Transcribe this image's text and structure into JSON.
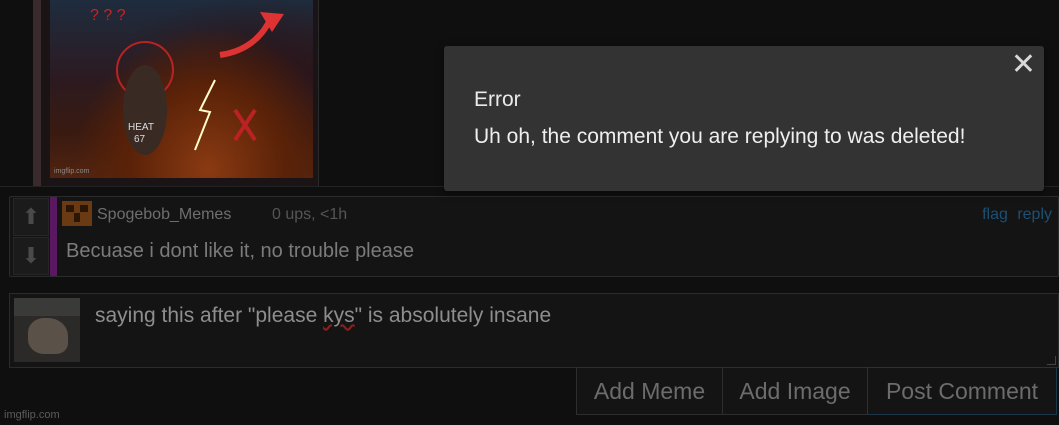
{
  "meme": {
    "watermark": "imgflip.com",
    "icon": "meme-image"
  },
  "comment": {
    "username": "Spogebob_Memes",
    "meta": "0 ups, <1h",
    "actions": {
      "flag": "flag",
      "reply": "reply"
    },
    "text": "Becuase i dont like it, no trouble please",
    "accent_color": "#5a1862"
  },
  "reply_box": {
    "value_before": "saying this after \"please ",
    "value_misspelled": "kys",
    "value_after": "\" is absolutely insane"
  },
  "buttons": {
    "add_meme": "Add Meme",
    "add_image": "Add Image",
    "post_comment": "Post Comment"
  },
  "footer": {
    "brand": "imgflip.com"
  },
  "modal": {
    "title": "Error",
    "message": "Uh oh, the comment you are replying to was deleted!",
    "close_symbol": "✕"
  }
}
